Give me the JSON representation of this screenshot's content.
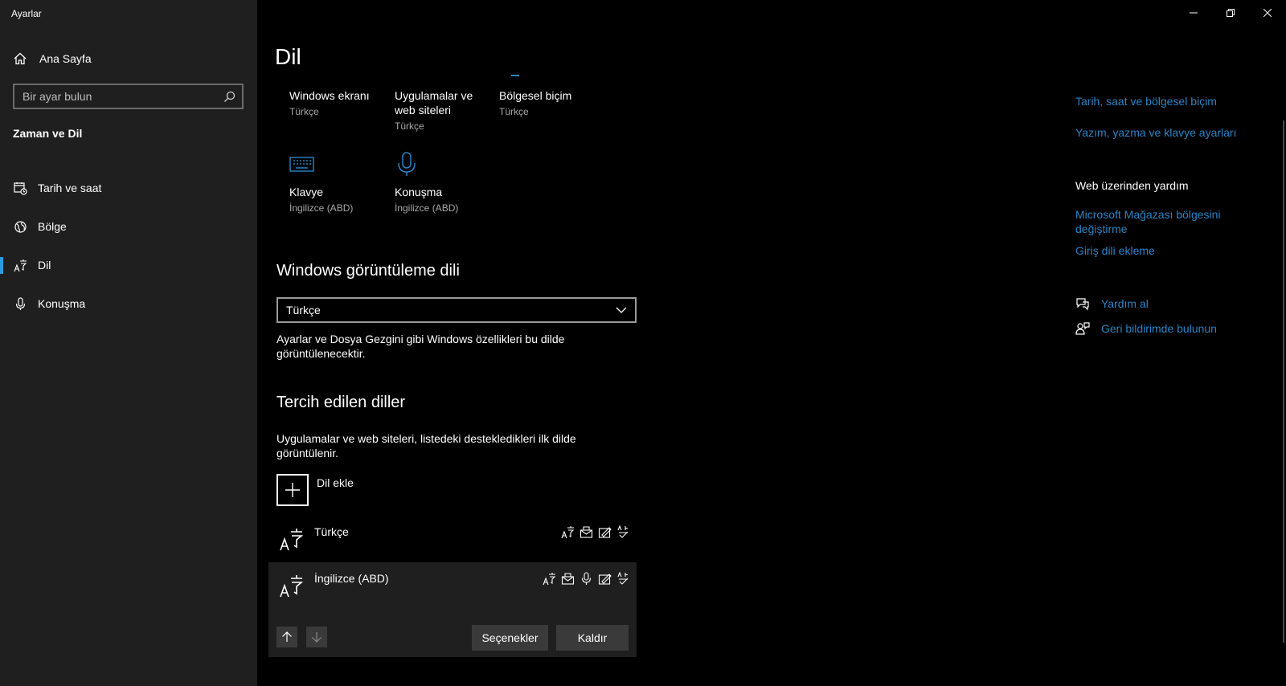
{
  "window": {
    "title": "Ayarlar"
  },
  "sidebar": {
    "home_label": "Ana Sayfa",
    "search_placeholder": "Bir ayar bulun",
    "section_title": "Zaman ve Dil",
    "items": [
      {
        "label": "Tarih ve saat",
        "icon": "calendar-clock-icon"
      },
      {
        "label": "Bölge",
        "icon": "globe-icon"
      },
      {
        "label": "Dil",
        "icon": "language-icon",
        "active": true
      },
      {
        "label": "Konuşma",
        "icon": "microphone-icon"
      }
    ]
  },
  "main": {
    "title": "Dil",
    "tiles": [
      {
        "label": "Windows ekranı",
        "sub": "Türkçe"
      },
      {
        "label": "Uygulamalar ve web siteleri",
        "sub": "Türkçe"
      },
      {
        "label": "Bölgesel biçim",
        "sub": "Türkçe"
      },
      {
        "label": "Klavye",
        "sub": "İngilizce (ABD)",
        "icon": "keyboard-icon"
      },
      {
        "label": "Konuşma",
        "sub": "İngilizce (ABD)",
        "icon": "microphone-icon"
      }
    ],
    "display_language": {
      "heading": "Windows görüntüleme dili",
      "selected": "Türkçe",
      "description": "Ayarlar ve Dosya Gezgini gibi Windows özellikleri bu dilde görüntülenecektir."
    },
    "preferred": {
      "heading": "Tercih edilen diller",
      "description": "Uygulamalar ve web siteleri, listedeki destekledikleri ilk dilde görüntülenir.",
      "add_label": "Dil ekle",
      "languages": [
        {
          "name": "Türkçe",
          "features": [
            "display-language-icon",
            "tts-icon",
            "handwriting-icon",
            "spellcheck-icon"
          ]
        },
        {
          "name": "İngilizce (ABD)",
          "features": [
            "display-language-icon",
            "tts-icon",
            "speech-icon",
            "handwriting-icon",
            "spellcheck-icon"
          ],
          "selected": true
        }
      ],
      "options_label": "Seçenekler",
      "remove_label": "Kaldır"
    }
  },
  "related": {
    "links": [
      "Tarih, saat ve bölgesel biçim",
      "Yazım, yazma ve klavye ayarları"
    ],
    "help_heading": "Web üzerinden yardım",
    "help_links": [
      "Microsoft Mağazası bölgesini değiştirme",
      "Giriş dili ekleme"
    ],
    "get_help": "Yardım al",
    "feedback": "Geri bildirimde bulunun"
  },
  "colors": {
    "accent": "#2b84c5",
    "sidebar_bg": "#1f1f1f",
    "main_bg": "#000000"
  }
}
